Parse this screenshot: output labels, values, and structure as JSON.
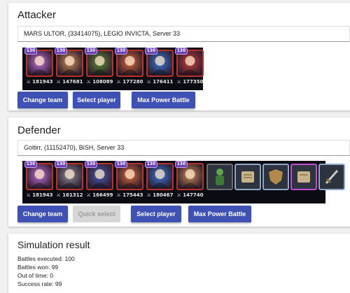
{
  "attacker": {
    "title": "Attacker",
    "player": "MARS ULTOR, (33414075), LEGIO INVICTA, Server 33",
    "heroes": [
      {
        "level": "130",
        "power": "181943",
        "color": "#c070d8"
      },
      {
        "level": "130",
        "power": "147681",
        "color": "#c98a5a"
      },
      {
        "level": "130",
        "power": "108089",
        "color": "#5e8a3a"
      },
      {
        "level": "130",
        "power": "177280",
        "color": "#d86a3a"
      },
      {
        "level": "130",
        "power": "176411",
        "color": "#3a7ad8"
      },
      {
        "level": "130",
        "power": "177350",
        "color": "#c84040"
      }
    ],
    "buttons": {
      "change_team": "Change team",
      "select_player": "Select player",
      "max_power": "Max Power Battle"
    }
  },
  "defender": {
    "title": "Defender",
    "player": "Goltirr, (11152470), BiSH, Server 33",
    "heroes": [
      {
        "level": "130",
        "power": "181943",
        "color": "#c070d8"
      },
      {
        "level": "130",
        "power": "161312",
        "color": "#8a8a9a"
      },
      {
        "level": "130",
        "power": "166499",
        "color": "#4a5ab0"
      },
      {
        "level": "130",
        "power": "175443",
        "color": "#d86a3a"
      },
      {
        "level": "130",
        "power": "180467",
        "color": "#3a7ad8"
      },
      {
        "level": "130",
        "power": "147740",
        "color": "#c98a5a"
      }
    ],
    "pets": [
      {
        "icon": "figure-pet-icon"
      },
      {
        "icon": "scroll-pet-icon"
      },
      {
        "icon": "shield-pet-icon"
      },
      {
        "icon": "scroll-purple-pet-icon"
      },
      {
        "icon": "sword-pet-icon"
      }
    ],
    "buttons": {
      "change_team": "Change team",
      "quick_select": "Quick select",
      "select_player": "Select player",
      "max_power": "Max Power Battle"
    }
  },
  "simulation": {
    "title": "Simulation result",
    "battles_executed": "Battles executed: 100",
    "battles_won": "Battles won: 99",
    "out_of_time": "Out of time: 0",
    "success_rate": "Success rate: 99"
  },
  "colors": {
    "accent": "#3f51b5",
    "frame": "#b8332a",
    "level_badge": "#6a3fb0"
  }
}
